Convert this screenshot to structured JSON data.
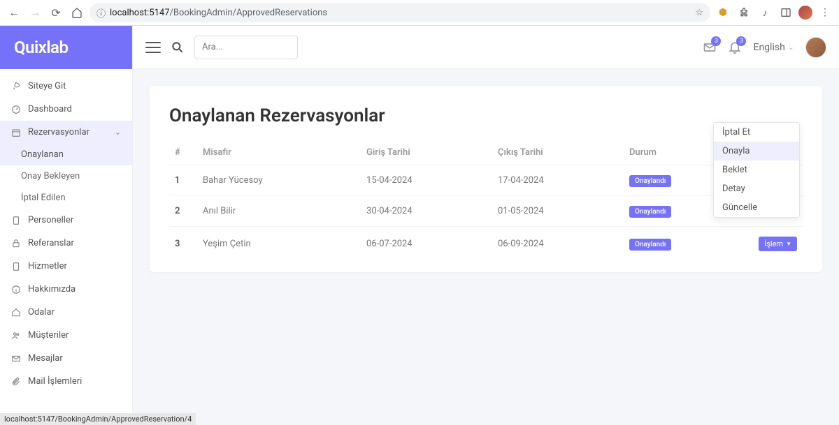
{
  "browser": {
    "url_prefix": "localhost:5147",
    "url_path": "/BookingAdmin/ApprovedReservations",
    "status_url": "localhost:5147/BookingAdmin/ApprovedReservation/4"
  },
  "brand": "Quixlab",
  "search_placeholder": "Ara...",
  "notif_badge1": "3",
  "notif_badge2": "3",
  "language": "English",
  "sidebar": {
    "items": [
      {
        "label": "Siteye Git"
      },
      {
        "label": "Dashboard"
      },
      {
        "label": "Rezervasyonlar",
        "expanded": true,
        "children": [
          {
            "label": "Onaylanan",
            "active": true
          },
          {
            "label": "Onay Bekleyen"
          },
          {
            "label": "İptal Edilen"
          }
        ]
      },
      {
        "label": "Personeller"
      },
      {
        "label": "Referanslar"
      },
      {
        "label": "Hizmetler"
      },
      {
        "label": "Hakkımızda"
      },
      {
        "label": "Odalar"
      },
      {
        "label": "Müşteriler"
      },
      {
        "label": "Mesajlar"
      },
      {
        "label": "Mail İşlemleri"
      }
    ]
  },
  "page_title": "Onaylanan Rezervasyonlar",
  "table": {
    "headers": [
      "#",
      "Misafir",
      "Giriş Tarihi",
      "Çıkış Tarihi",
      "Durum",
      ""
    ],
    "rows": [
      {
        "id": "1",
        "guest": "Bahar Yücesoy",
        "checkin": "15-04-2024",
        "checkout": "17-04-2024",
        "status": "Onaylandı"
      },
      {
        "id": "2",
        "guest": "Anıl Bilir",
        "checkin": "30-04-2024",
        "checkout": "01-05-2024",
        "status": "Onaylandı"
      },
      {
        "id": "3",
        "guest": "Yeşim Çetin",
        "checkin": "06-07-2024",
        "checkout": "06-09-2024",
        "status": "Onaylandı"
      }
    ],
    "action_label": "İşlem"
  },
  "dropdown": {
    "items": [
      "İptal Et",
      "Onayla",
      "Beklet",
      "Detay",
      "Güncelle"
    ],
    "hovered_index": 1
  }
}
